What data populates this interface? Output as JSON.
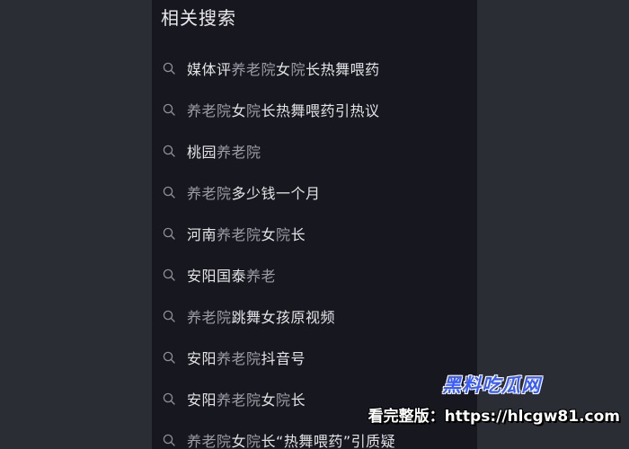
{
  "section": {
    "title": "相关搜索"
  },
  "icons": {
    "search": "search-icon"
  },
  "colors": {
    "panel_background": "#17171f",
    "page_background": "#2b2d34",
    "text_primary": "#e2e2e7",
    "text_highlight": "#9c9ca6",
    "watermark_brand": "#3a5cff"
  },
  "suggestions": [
    {
      "segments": [
        {
          "text": "媒体评",
          "hl": false
        },
        {
          "text": "养老院",
          "hl": true
        },
        {
          "text": "女",
          "hl": false
        },
        {
          "text": "院",
          "hl": true
        },
        {
          "text": "长热舞喂药",
          "hl": false
        }
      ]
    },
    {
      "segments": [
        {
          "text": "养老院",
          "hl": true
        },
        {
          "text": "女",
          "hl": false
        },
        {
          "text": "院",
          "hl": true
        },
        {
          "text": "长热舞喂药引热议",
          "hl": false
        }
      ]
    },
    {
      "segments": [
        {
          "text": "桃园",
          "hl": false
        },
        {
          "text": "养老院",
          "hl": true
        }
      ]
    },
    {
      "segments": [
        {
          "text": "养老院",
          "hl": true
        },
        {
          "text": "多少钱一个月",
          "hl": false
        }
      ]
    },
    {
      "segments": [
        {
          "text": "河南",
          "hl": false
        },
        {
          "text": "养老院",
          "hl": true
        },
        {
          "text": "女",
          "hl": false
        },
        {
          "text": "院",
          "hl": true
        },
        {
          "text": "长",
          "hl": false
        }
      ]
    },
    {
      "segments": [
        {
          "text": "安阳国泰",
          "hl": false
        },
        {
          "text": "养老",
          "hl": true
        }
      ]
    },
    {
      "segments": [
        {
          "text": "养老院",
          "hl": true
        },
        {
          "text": "跳舞女孩原视频",
          "hl": false
        }
      ]
    },
    {
      "segments": [
        {
          "text": "安阳",
          "hl": false
        },
        {
          "text": "养老院",
          "hl": true
        },
        {
          "text": "抖音号",
          "hl": false
        }
      ]
    },
    {
      "segments": [
        {
          "text": "安阳",
          "hl": false
        },
        {
          "text": "养老院",
          "hl": true
        },
        {
          "text": "女",
          "hl": false
        },
        {
          "text": "院",
          "hl": true
        },
        {
          "text": "长",
          "hl": false
        }
      ]
    },
    {
      "segments": [
        {
          "text": "养老院",
          "hl": true
        },
        {
          "text": "女",
          "hl": false
        },
        {
          "text": "院",
          "hl": true
        },
        {
          "text": "长“热舞喂药”引质疑",
          "hl": false
        }
      ]
    }
  ],
  "watermark": {
    "logo": "黑料吃瓜网",
    "url_text": "看完整版：https://hlcgw81.com"
  }
}
